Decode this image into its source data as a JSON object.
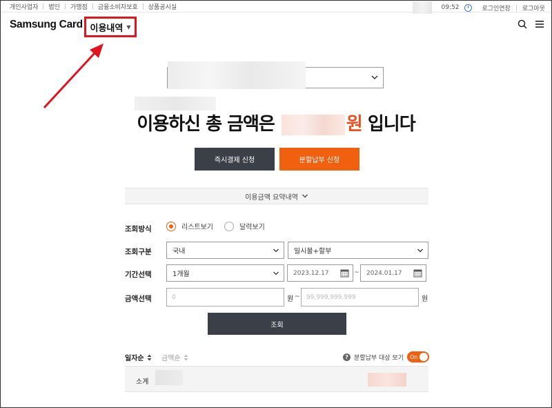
{
  "topbar": {
    "links": [
      "개인사업자",
      "법인",
      "가맹점",
      "금융소비자보호",
      "상품공시실"
    ],
    "time": "09:52",
    "login_extend": "로그인연장",
    "logout": "로그아웃"
  },
  "header": {
    "logo": "Samsung Card",
    "menu_label": "이용내역",
    "highlight_color": "#e0141e"
  },
  "total": {
    "prefix": "이용하신 총 금액은",
    "currency": "원",
    "suffix": "입니다"
  },
  "actions": {
    "instant_pay": "즉시결제 신청",
    "installment_apply": "분할납부 신청"
  },
  "summary_toggle": "이용금액 요약내역",
  "form": {
    "method_label": "조회방식",
    "method_options": [
      "리스트보기",
      "달력보기"
    ],
    "method_selected": "리스트보기",
    "category_label": "조회구분",
    "category_value": "국내",
    "payment_value": "일시불+할부",
    "period_label": "기간선택",
    "period_value": "1개월",
    "date_from": "2023.12.17",
    "date_to": "2024.01.17",
    "date_sep": "~",
    "amount_label": "금액선택",
    "amount_min_placeholder": "0",
    "amount_max_placeholder": "99,999,999,999",
    "amount_unit": "원",
    "amount_sep": "~",
    "search_button": "조회"
  },
  "results": {
    "sort_date": "일자순",
    "sort_amount": "금액순",
    "installment_filter": "분할납부 대상 보기",
    "toggle_state": "On",
    "subtotal_label": "소계"
  },
  "colors": {
    "accent": "#f0600e",
    "dark_button": "#3a3f48"
  }
}
